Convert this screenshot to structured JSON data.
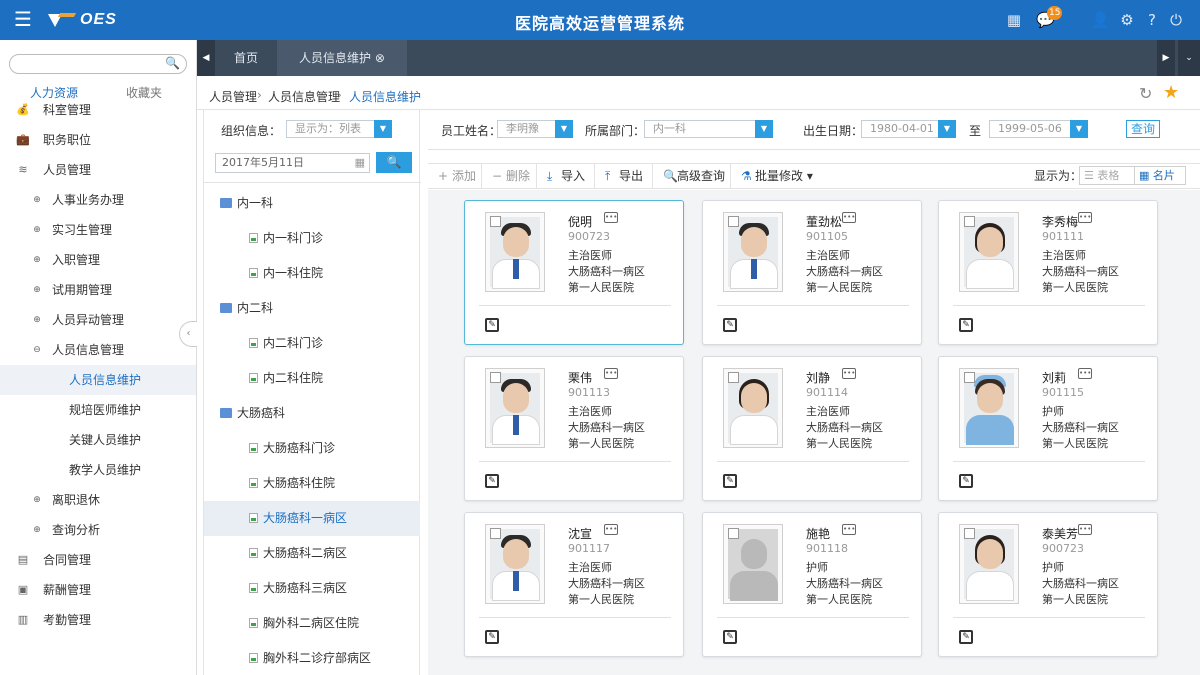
{
  "header": {
    "logo_text": "OES",
    "title": "医院高效运营管理系统",
    "menu_icon": "hamburger-icon",
    "notification_count": "15",
    "icons": [
      "grid-icon",
      "message-icon",
      "user-icon",
      "gear-icon",
      "help-icon",
      "power-icon"
    ]
  },
  "sidebar": {
    "search_placeholder": "",
    "tabs": [
      "人力资源",
      "收藏夹"
    ],
    "items": [
      {
        "label": "科室管理",
        "level": 1,
        "icon": "money-bag-icon"
      },
      {
        "label": "职务职位",
        "level": 1,
        "icon": "briefcase-icon"
      },
      {
        "label": "人员管理",
        "level": 1,
        "icon": "layers-icon"
      },
      {
        "label": "人事业务办理",
        "level": 2,
        "icon": "plus-circle-icon"
      },
      {
        "label": "实习生管理",
        "level": 2,
        "icon": "plus-circle-icon"
      },
      {
        "label": "入职管理",
        "level": 2,
        "icon": "plus-circle-icon"
      },
      {
        "label": "试用期管理",
        "level": 2,
        "icon": "plus-circle-icon"
      },
      {
        "label": "人员异动管理",
        "level": 2,
        "icon": "plus-circle-icon"
      },
      {
        "label": "人员信息管理",
        "level": 2,
        "icon": "minus-circle-icon"
      },
      {
        "label": "人员信息维护",
        "level": 3,
        "active": true
      },
      {
        "label": "规培医师维护",
        "level": 3
      },
      {
        "label": "关键人员维护",
        "level": 3
      },
      {
        "label": "教学人员维护",
        "level": 3
      },
      {
        "label": "离职退休",
        "level": 2,
        "icon": "plus-circle-icon"
      },
      {
        "label": "查询分析",
        "level": 2,
        "icon": "plus-circle-icon"
      },
      {
        "label": "合同管理",
        "level": 1,
        "icon": "contract-icon"
      },
      {
        "label": "薪酬管理",
        "level": 1,
        "icon": "salary-icon"
      },
      {
        "label": "考勤管理",
        "level": 1,
        "icon": "attendance-icon"
      }
    ]
  },
  "tabs": {
    "home": "首页",
    "current": "人员信息维护"
  },
  "breadcrumb": [
    "人员管理",
    "人员信息管理",
    "人员信息维护"
  ],
  "tree": {
    "org_label": "组织信息：",
    "display_value": "显示为：列表",
    "date_value": "2017年5月11日",
    "nodes": [
      {
        "label": "内一科",
        "type": "dept"
      },
      {
        "label": "内一科门诊",
        "type": "leaf"
      },
      {
        "label": "内一科住院",
        "type": "leaf"
      },
      {
        "label": "内二科",
        "type": "dept"
      },
      {
        "label": "内二科门诊",
        "type": "leaf"
      },
      {
        "label": "内二科住院",
        "type": "leaf"
      },
      {
        "label": "大肠癌科",
        "type": "dept"
      },
      {
        "label": "大肠癌科门诊",
        "type": "leaf"
      },
      {
        "label": "大肠癌科住院",
        "type": "leaf"
      },
      {
        "label": "大肠癌科一病区",
        "type": "leaf",
        "active": true
      },
      {
        "label": "大肠癌科二病区",
        "type": "leaf"
      },
      {
        "label": "大肠癌科三病区",
        "type": "leaf"
      },
      {
        "label": "胸外科二病区住院",
        "type": "leaf"
      },
      {
        "label": "胸外科二诊疗部病区",
        "type": "leaf"
      }
    ]
  },
  "filters": {
    "name_label": "员工姓名：",
    "name_value": "李明豫",
    "dept_label": "所属部门：",
    "dept_value": "内一科",
    "birth_label": "出生日期：",
    "birth_from": "1980-04-01",
    "to_label": "至",
    "birth_to": "1999-05-06",
    "query_button": "查询"
  },
  "toolbar": {
    "add": "添加",
    "delete": "删除",
    "import": "导入",
    "export": "导出",
    "advanced": "高级查询",
    "batch": "批量修改",
    "display_label": "显示为：",
    "view_table": "表格",
    "view_card": "名片"
  },
  "cards": [
    {
      "name": "倪明",
      "id": "900723",
      "title": "主治医师",
      "dept": "大肠癌科一病区",
      "hospital": "第一人民医院",
      "photo": "man"
    },
    {
      "name": "董劲松",
      "id": "901105",
      "title": "主治医师",
      "dept": "大肠癌科一病区",
      "hospital": "第一人民医院",
      "photo": "man"
    },
    {
      "name": "李秀梅",
      "id": "901111",
      "title": "主治医师",
      "dept": "大肠癌科一病区",
      "hospital": "第一人民医院",
      "photo": "woman"
    },
    {
      "name": "栗伟",
      "id": "901113",
      "title": "主治医师",
      "dept": "大肠癌科一病区",
      "hospital": "第一人民医院",
      "photo": "man"
    },
    {
      "name": "刘静",
      "id": "901114",
      "title": "主治医师",
      "dept": "大肠癌科一病区",
      "hospital": "第一人民医院",
      "photo": "woman"
    },
    {
      "name": "刘莉",
      "id": "901115",
      "title": "护师",
      "dept": "大肠癌科一病区",
      "hospital": "第一人民医院",
      "photo": "nurse"
    },
    {
      "name": "沈宣",
      "id": "901117",
      "title": "主治医师",
      "dept": "大肠癌科一病区",
      "hospital": "第一人民医院",
      "photo": "man"
    },
    {
      "name": "施艳",
      "id": "901118",
      "title": "护师",
      "dept": "大肠癌科一病区",
      "hospital": "第一人民医院",
      "photo": "none"
    },
    {
      "name": "泰美芳",
      "id": "900723",
      "title": "护师",
      "dept": "大肠癌科一病区",
      "hospital": "第一人民医院",
      "photo": "woman"
    }
  ],
  "colors": {
    "primary": "#1d6fc1",
    "accent_button": "#2c9ee0",
    "tab_bar": "#3c4b5c",
    "badge": "#f28e1b",
    "star": "#f2a51a"
  }
}
